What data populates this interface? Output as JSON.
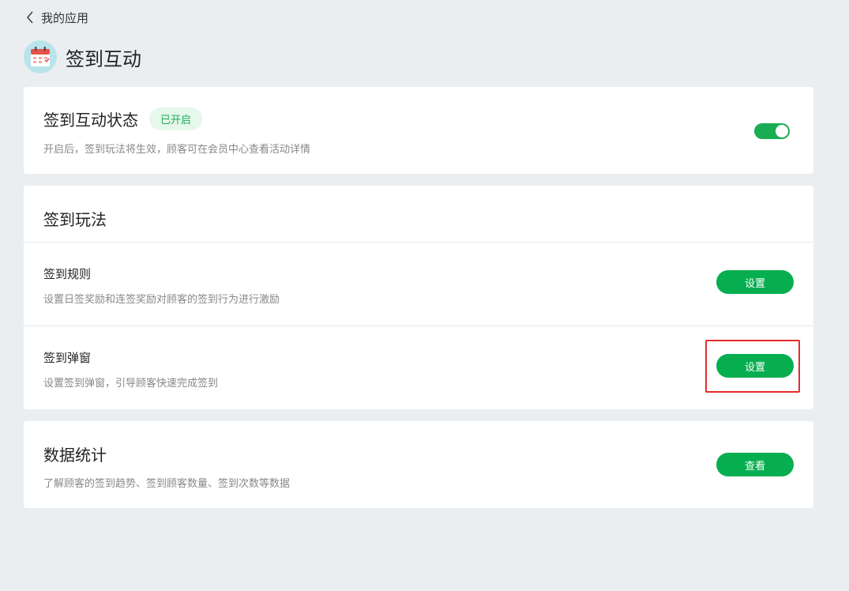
{
  "nav": {
    "back_label": "我的应用"
  },
  "app": {
    "title": "签到互动"
  },
  "status": {
    "title": "签到互动状态",
    "badge": "已开启",
    "description": "开启后，签到玩法将生效，顾客可在会员中心查看活动详情",
    "enabled": true
  },
  "play": {
    "title": "签到玩法",
    "items": [
      {
        "title": "签到规则",
        "description": "设置日签奖励和连签奖励对顾客的签到行为进行激励",
        "button": "设置"
      },
      {
        "title": "签到弹窗",
        "description": "设置签到弹窗，引导顾客快速完成签到",
        "button": "设置"
      }
    ]
  },
  "stats": {
    "title": "数据统计",
    "description": "了解顾客的签到趋势、签到顾客数量、签到次数等数据",
    "button": "查看"
  },
  "colors": {
    "primary": "#07ae4f",
    "badge_bg": "#e6f7ec",
    "highlight": "#e52b2b",
    "page_bg": "#ebeef1"
  }
}
